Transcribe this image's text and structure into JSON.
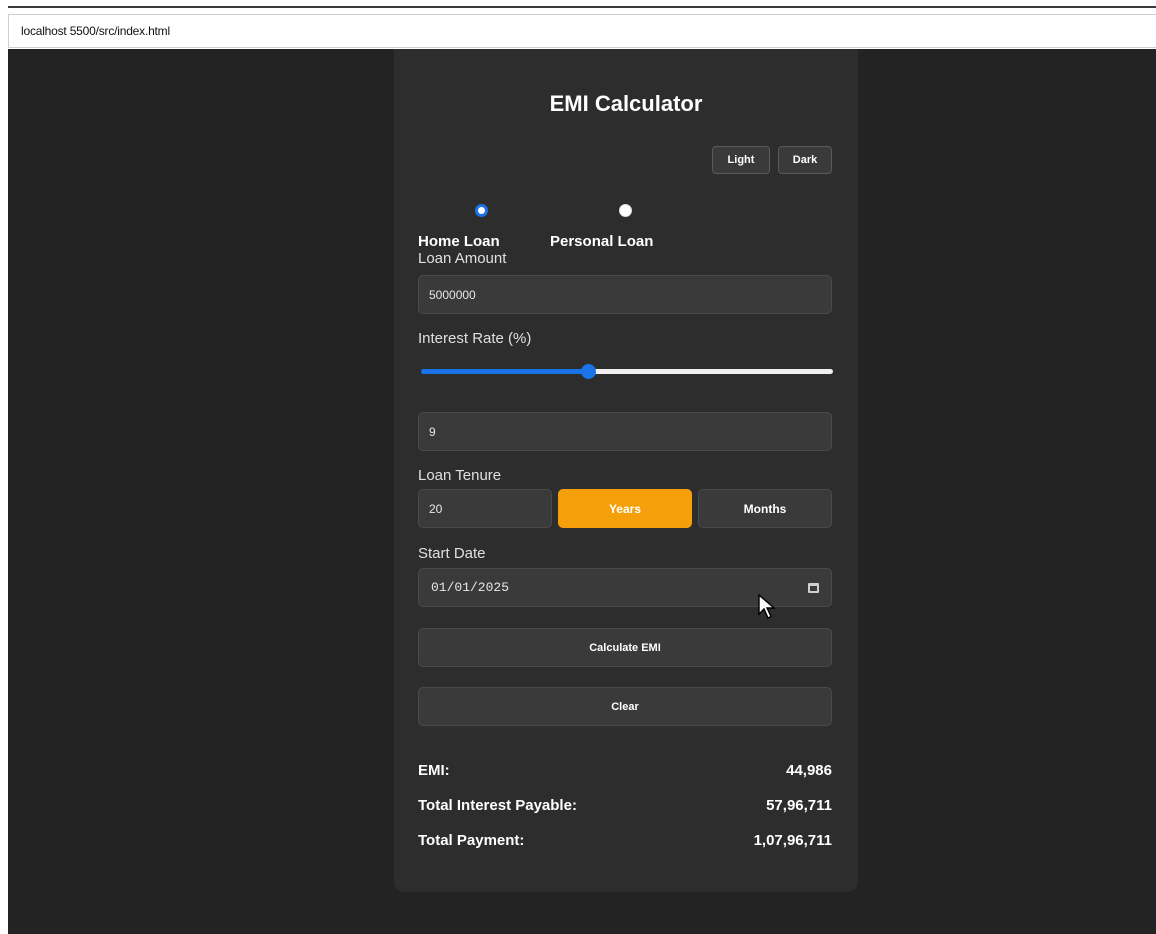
{
  "browser": {
    "url": "localhost 5500/src/index.html"
  },
  "app": {
    "title": "EMI Calculator",
    "theme_buttons": {
      "light": "Light",
      "dark": "Dark"
    },
    "loan_types": {
      "home": "Home Loan",
      "personal": "Personal Loan",
      "selected": "home"
    },
    "loan_amount": {
      "label": "Loan Amount",
      "value": "5000000"
    },
    "interest_rate": {
      "label": "Interest Rate (%)",
      "value": "9",
      "slider_fraction": 0.41
    },
    "loan_tenure": {
      "label": "Loan Tenure",
      "value": "20",
      "years_label": "Years",
      "months_label": "Months",
      "selected_unit": "Years"
    },
    "start_date": {
      "label": "Start Date",
      "value": "01/01/2025"
    },
    "buttons": {
      "calculate": "Calculate EMI",
      "clear": "Clear"
    },
    "results": {
      "emi_label": "EMI:",
      "emi_value": "44,986",
      "interest_label": "Total Interest Payable:",
      "interest_value": "57,96,711",
      "total_label": "Total Payment:",
      "total_value": "1,07,96,711"
    },
    "colors": {
      "accent": "#1a73e8",
      "selected_unit": "#f5a00b",
      "card_bg": "#2d2d2d",
      "page_bg": "#232323"
    }
  }
}
